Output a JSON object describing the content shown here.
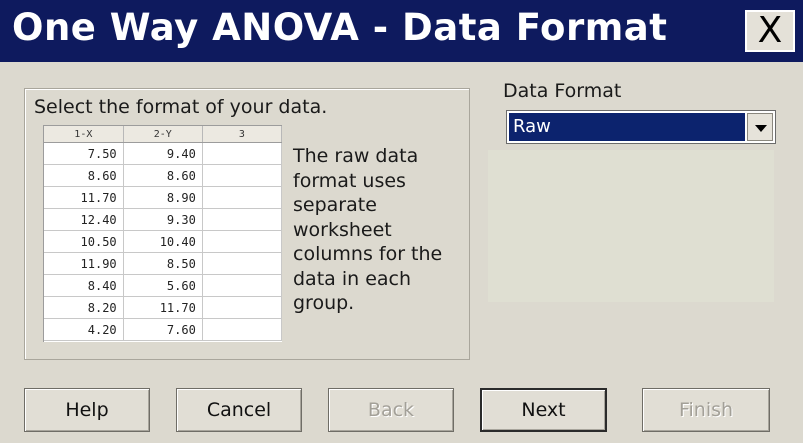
{
  "window": {
    "title": "One Way ANOVA - Data Format",
    "close_label": "X"
  },
  "left_group": {
    "prompt": "Select the format of your data.",
    "worksheet": {
      "columns": [
        "1-X",
        "2-Y",
        "3"
      ],
      "rows": [
        [
          "7.50",
          "9.40",
          ""
        ],
        [
          "8.60",
          "8.60",
          ""
        ],
        [
          "11.70",
          "8.90",
          ""
        ],
        [
          "12.40",
          "9.30",
          ""
        ],
        [
          "10.50",
          "10.40",
          ""
        ],
        [
          "11.90",
          "8.50",
          ""
        ],
        [
          "8.40",
          "5.60",
          ""
        ],
        [
          "8.20",
          "11.70",
          ""
        ],
        [
          "4.20",
          "7.60",
          ""
        ]
      ]
    },
    "description": "The raw data format uses separate worksheet columns for the data in each group."
  },
  "data_format": {
    "label": "Data Format",
    "selected": "Raw"
  },
  "buttons": {
    "help": "Help",
    "cancel": "Cancel",
    "back": "Back",
    "next": "Next",
    "finish": "Finish"
  },
  "colors": {
    "title_bar": "#0e1a5e",
    "dialog_bg": "#dcd9cf",
    "selection": "#0c236e",
    "preview_panel": "#dfdfd2"
  }
}
